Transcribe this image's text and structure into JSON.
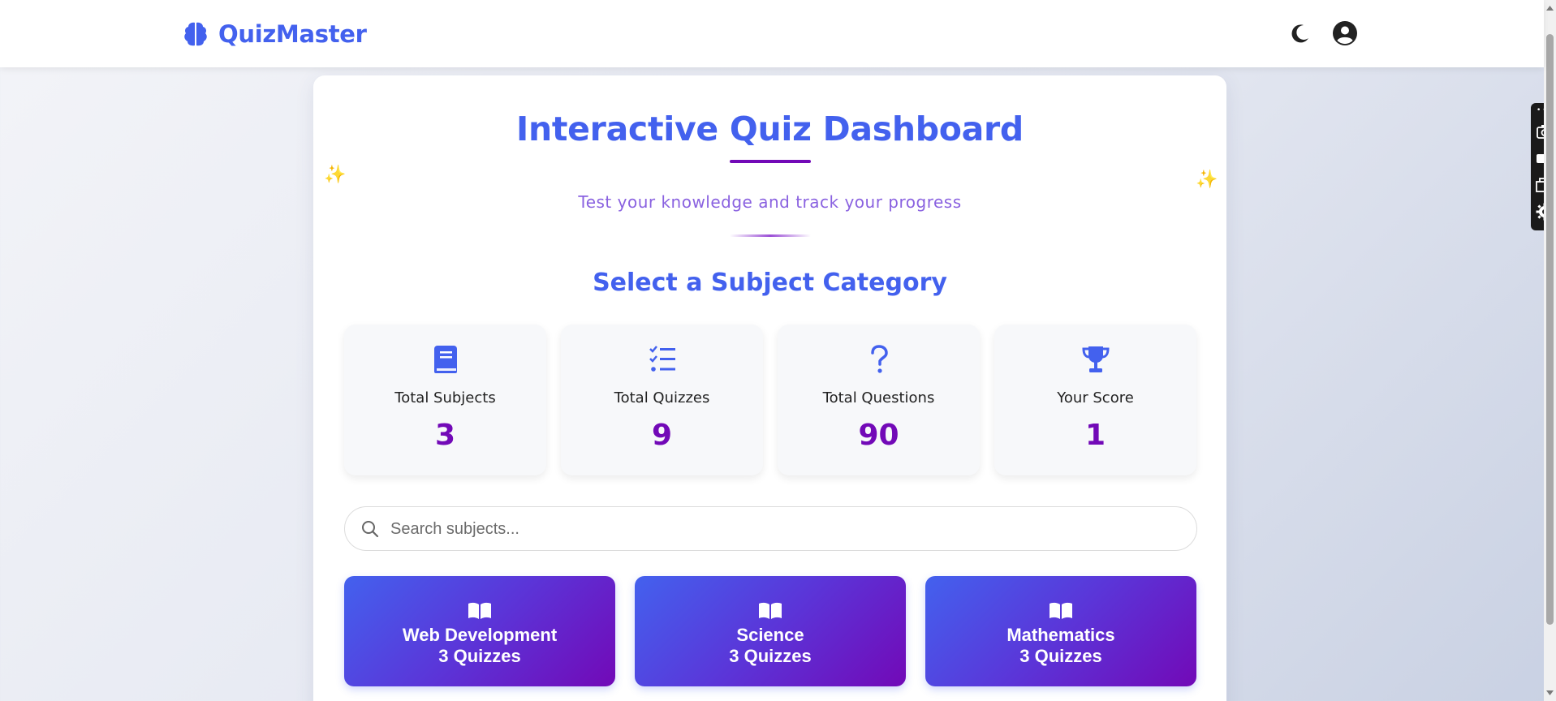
{
  "app": {
    "brand": "QuizMaster"
  },
  "header": {
    "icons": {
      "logo": "brain-icon",
      "theme": "moon-icon",
      "account": "user-circle-icon"
    }
  },
  "hero": {
    "title": "Interactive Quiz Dashboard",
    "subtitle": "Test your knowledge and track your progress",
    "sparkle": "✨"
  },
  "section": {
    "heading": "Select a Subject Category"
  },
  "stats": [
    {
      "label": "Total Subjects",
      "value": "3",
      "icon": "book-icon"
    },
    {
      "label": "Total Quizzes",
      "value": "9",
      "icon": "list-check-icon"
    },
    {
      "label": "Total Questions",
      "value": "90",
      "icon": "question-icon"
    },
    {
      "label": "Your Score",
      "value": "1",
      "icon": "trophy-icon"
    }
  ],
  "search": {
    "placeholder": "Search subjects...",
    "value": ""
  },
  "subjects": [
    {
      "name": "Web Development",
      "count": "3 Quizzes"
    },
    {
      "name": "Science",
      "count": "3 Quizzes"
    },
    {
      "name": "Mathematics",
      "count": "3 Quizzes"
    }
  ],
  "colors": {
    "primary": "#4361ee",
    "secondary": "#7209b7",
    "sparkle": "#f7b731"
  }
}
